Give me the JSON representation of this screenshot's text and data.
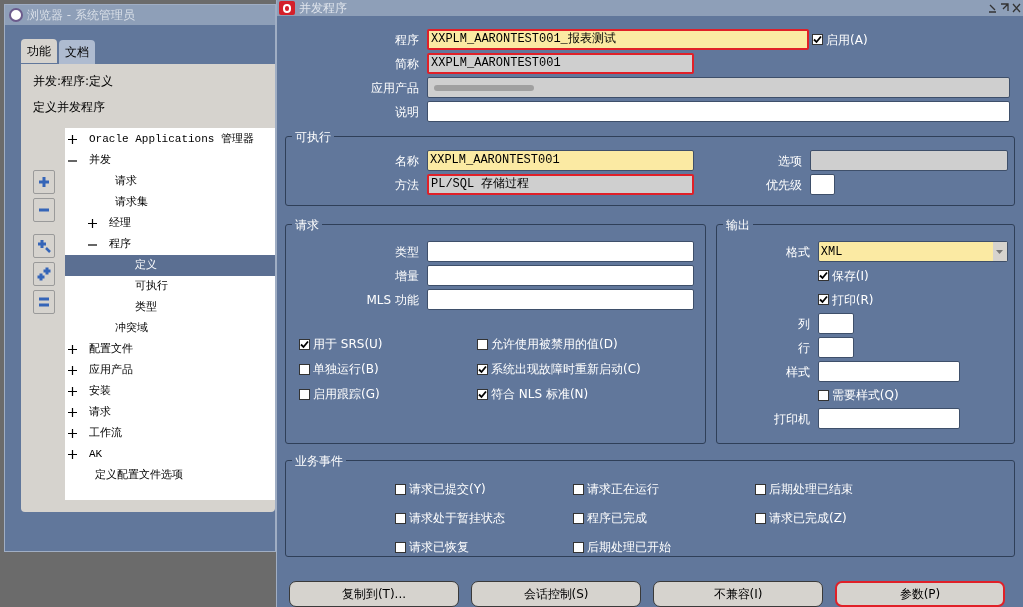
{
  "navigator": {
    "title": "浏览器 - 系统管理员",
    "tabs": [
      {
        "label": "功能",
        "selected": true
      },
      {
        "label": "文档",
        "selected": false
      }
    ],
    "path": "并发:程序:定义",
    "description": "定义并发程序",
    "tree": [
      {
        "label": "Oracle Applications 管理器",
        "kind": "branch",
        "expanded": false,
        "selected": false
      },
      {
        "label": "并发",
        "kind": "branch",
        "expanded": true,
        "selected": false,
        "children": [
          {
            "label": "请求",
            "kind": "leaf",
            "selected": false
          },
          {
            "label": "请求集",
            "kind": "leaf",
            "selected": false
          },
          {
            "label": "经理",
            "kind": "branch",
            "expanded": false,
            "selected": false
          },
          {
            "label": "程序",
            "kind": "branch",
            "expanded": true,
            "selected": false,
            "children": [
              {
                "label": "定义",
                "kind": "leaf",
                "selected": true
              },
              {
                "label": "可执行",
                "kind": "leaf",
                "selected": false
              },
              {
                "label": "类型",
                "kind": "leaf",
                "selected": false
              }
            ]
          },
          {
            "label": "冲突域",
            "kind": "leaf",
            "selected": false
          }
        ]
      },
      {
        "label": "配置文件",
        "kind": "branch",
        "expanded": false,
        "selected": false
      },
      {
        "label": "应用产品",
        "kind": "branch",
        "expanded": false,
        "selected": false
      },
      {
        "label": "安装",
        "kind": "branch",
        "expanded": false,
        "selected": false
      },
      {
        "label": "请求",
        "kind": "branch",
        "expanded": false,
        "selected": false
      },
      {
        "label": "工作流",
        "kind": "branch",
        "expanded": false,
        "selected": false
      },
      {
        "label": "AK",
        "kind": "branch",
        "expanded": false,
        "selected": false
      },
      {
        "label": "定义配置文件选项",
        "kind": "leaf",
        "selected": false
      }
    ]
  },
  "form": {
    "title": "并发程序",
    "fields": [
      {
        "label": "程序",
        "value": "XXPLM_AARONTEST001_报表测试",
        "kind": "required",
        "highlighted": true
      },
      {
        "label": "简称",
        "value": "XXPLM_AARONTEST001",
        "kind": "readonly",
        "highlighted": true
      },
      {
        "label": "应用产品",
        "kind": "obscured",
        "highlighted": false
      },
      {
        "label": "说明",
        "kind": "text",
        "highlighted": false
      }
    ],
    "enabled": {
      "label": "启用(A)",
      "checked": true
    },
    "executable": {
      "title": "可执行",
      "name": {
        "label": "名称",
        "value": "XXPLM_AARONTEST001",
        "kind": "required",
        "highlighted": false
      },
      "method": {
        "label": "方法",
        "value": "PL/SQL 存储过程",
        "kind": "readonly",
        "highlighted": true
      },
      "options": {
        "label": "选项",
        "kind": "readonly",
        "highlighted": false
      },
      "priority": {
        "label": "优先级",
        "kind": "text",
        "highlighted": false
      }
    },
    "request": {
      "title": "请求",
      "fields": [
        {
          "label": "类型",
          "kind": "text",
          "highlighted": false
        },
        {
          "label": "增量",
          "kind": "text",
          "highlighted": false
        },
        {
          "label": "MLS 功能",
          "kind": "text",
          "highlighted": false
        }
      ],
      "checks": [
        {
          "label": "用于 SRS(U)",
          "checked": true
        },
        {
          "label": "允许使用被禁用的值(D)",
          "checked": false
        },
        {
          "label": "单独运行(B)",
          "checked": false
        },
        {
          "label": "系统出现故障时重新启动(C)",
          "checked": true
        },
        {
          "label": "启用跟踪(G)",
          "checked": false
        },
        {
          "label": "符合 NLS 标准(N)",
          "checked": true
        }
      ]
    },
    "output": {
      "title": "输出",
      "format": {
        "label": "格式",
        "value": "XML",
        "kind": "required"
      },
      "save": {
        "label": "保存(I)",
        "checked": true
      },
      "print": {
        "label": "打印(R)",
        "checked": true
      },
      "columns": {
        "label": "列",
        "kind": "text",
        "highlighted": false
      },
      "rows": {
        "label": "行",
        "kind": "text",
        "highlighted": false
      },
      "style": {
        "label": "样式",
        "kind": "text",
        "highlighted": false
      },
      "style_required": {
        "label": "需要样式(Q)",
        "checked": false
      },
      "printer": {
        "label": "打印机",
        "kind": "text",
        "highlighted": false
      }
    },
    "events": {
      "title": "业务事件",
      "checks": [
        {
          "label": "请求已提交(Y)",
          "checked": false
        },
        {
          "label": "请求正在运行",
          "checked": false
        },
        {
          "label": "后期处理已结束",
          "checked": false
        },
        {
          "label": "请求处于暂挂状态",
          "checked": false
        },
        {
          "label": "程序已完成",
          "checked": false
        },
        {
          "label": "请求已完成(Z)",
          "checked": false
        },
        {
          "label": "请求已恢复",
          "checked": false
        },
        {
          "label": "后期处理已开始",
          "checked": false
        }
      ]
    },
    "buttons": [
      {
        "label": "复制到(T)...",
        "highlighted": false
      },
      {
        "label": "会话控制(S)",
        "highlighted": false
      },
      {
        "label": "不兼容(I)",
        "highlighted": false
      },
      {
        "label": "参数(P)",
        "highlighted": true
      }
    ]
  }
}
